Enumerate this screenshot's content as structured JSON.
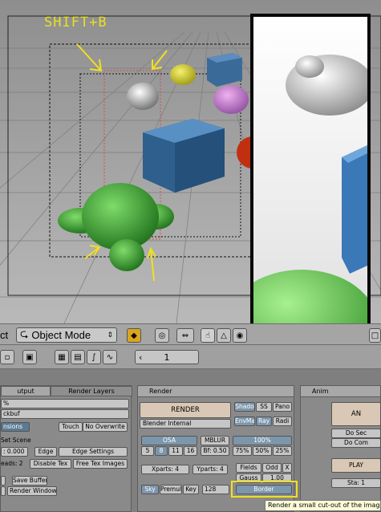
{
  "annotation": {
    "shortcut": "SHIFT+B"
  },
  "header": {
    "window_type_label": "ct",
    "mode": "Object Mode"
  },
  "buttons_header": {
    "frame": "1"
  },
  "panels": {
    "output": {
      "tab_output": "utput",
      "tab_render_layers": "Render Layers",
      "pct": "%",
      "ckbuf": "ckbuf",
      "extensions": "nsions",
      "touch": "Touch",
      "no_overwrite": "No Overwrite",
      "set_scene": "Set Scene",
      "value": ": 0.000",
      "edge": "Edge",
      "edge_settings": "Edge Settings",
      "threads": "eads: 2",
      "disable_tex": "Disable Tex",
      "free_tex_images": "Free Tex Images",
      "save_buffers": "Save Buffers",
      "render_window": "Render Window"
    },
    "render": {
      "title": "Render",
      "render_button": "RENDER",
      "engine": "Blender Internal",
      "shadow": "Shado",
      "sss": "SS",
      "pano": "Pano",
      "envmap": "EnvMa",
      "ray": "Ray",
      "radio": "Radi",
      "osa": "OSA",
      "mblur": "MBLUR",
      "pct100": "100%",
      "osa_5": "5",
      "osa_8": "8",
      "osa_11": "11",
      "osa_16": "16",
      "bf": "Bf: 0.50",
      "pct75": "75%",
      "pct50": "50%",
      "pct25": "25%",
      "xparts": "Xparts: 4",
      "yparts": "Yparts: 4",
      "fields": "Fields",
      "odd": "Odd",
      "x": "X",
      "gauss": "Gauss",
      "gauss_val": "1.00",
      "sky": "Sky",
      "premul": "Premul",
      "key": "Key",
      "bits": "128",
      "border": "Border"
    },
    "anim": {
      "title": "Anim",
      "anim_button": "AN",
      "do_seq": "Do Sec",
      "do_comp": "Do Com",
      "play": "PLAY",
      "sta": "Sta: 1"
    }
  },
  "tooltip": "Render a small cut-out of the image (S",
  "colors": {
    "annotation": "#e8e020",
    "highlight": "#f0e020"
  }
}
